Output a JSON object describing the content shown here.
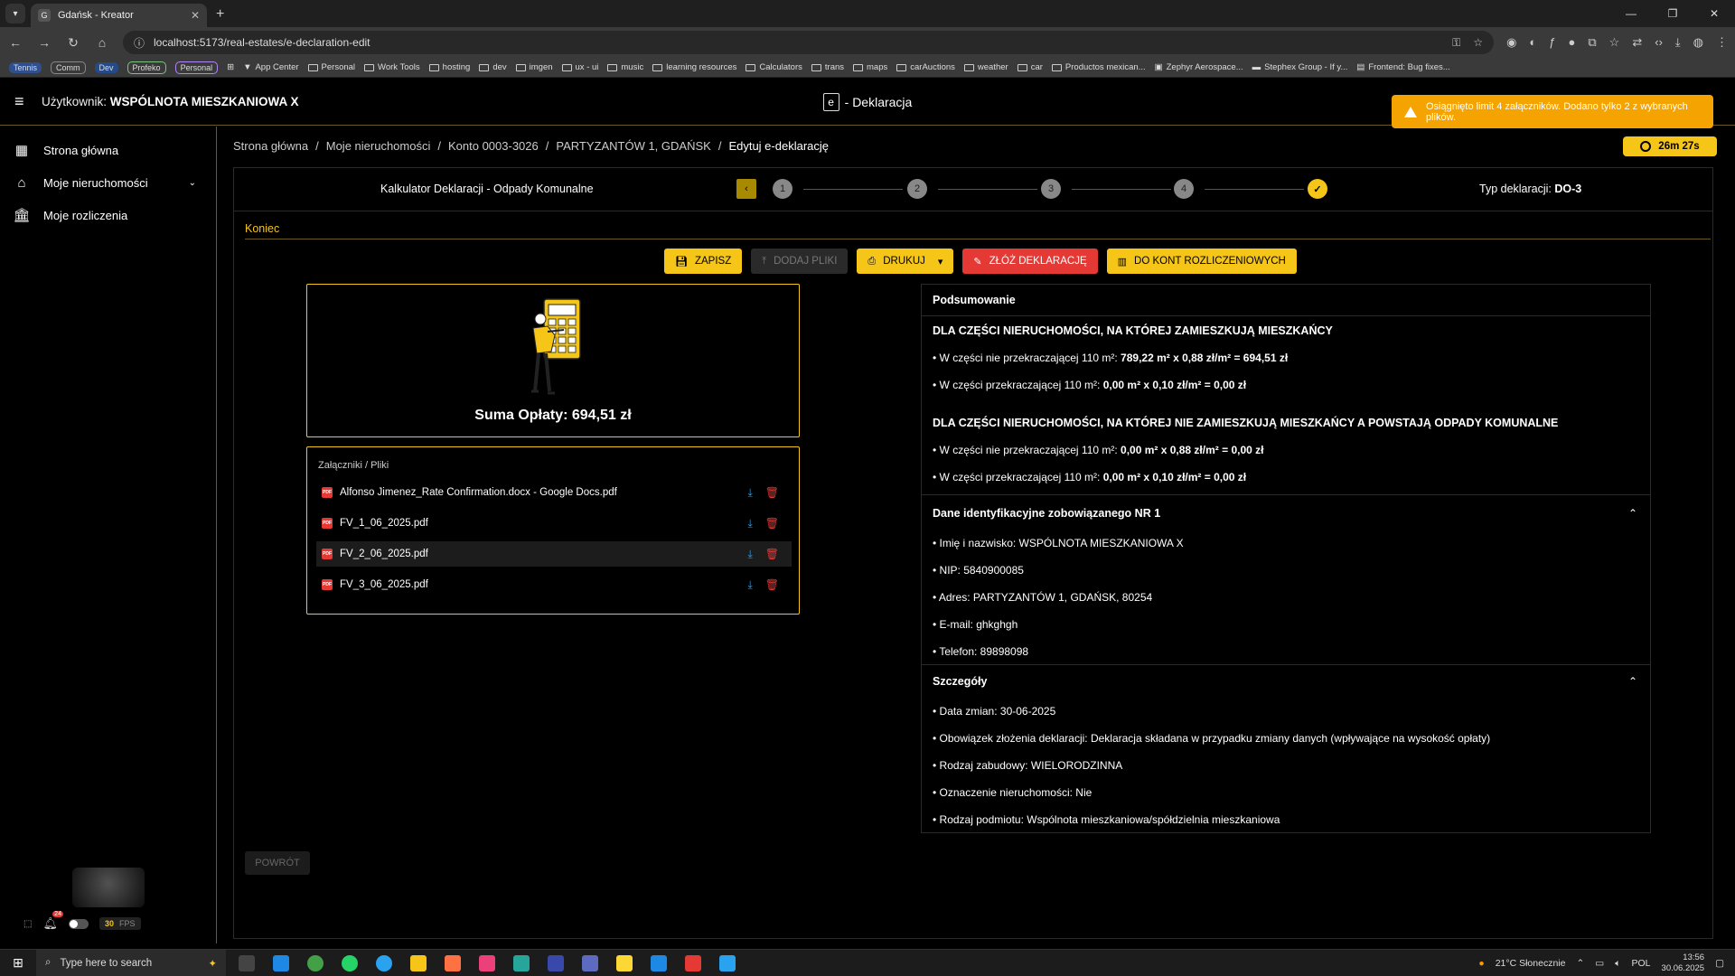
{
  "browser": {
    "tab_title": "Gdańsk - Kreator",
    "url": "localhost:5173/real-estates/e-declaration-edit",
    "bookmarks_pills": [
      "Tennis",
      "Comm",
      "Dev",
      "Profeko",
      "Personal"
    ],
    "bookmarks": [
      "App Center",
      "Personal",
      "Work Tools",
      "hosting",
      "dev",
      "imgen",
      "ux - ui",
      "music",
      "learning resources",
      "Calculators",
      "trans",
      "maps",
      "carAuctions",
      "weather",
      "car",
      "Productos mexican...",
      "Zephyr Aerospace...",
      "Stephex Group - If y...",
      "Frontend: Bug fixes..."
    ]
  },
  "header": {
    "user_prefix": "Użytkownik:",
    "user_name": "WSPÓLNOTA MIESZKANIOWA X",
    "e_letter": "e",
    "title": "- Deklaracja"
  },
  "toast": {
    "message": "Osiągnięto limit 4 załączników. Dodano tylko 2 z wybranych plików."
  },
  "sidebar": {
    "items": [
      {
        "label": "Strona główna"
      },
      {
        "label": "Moje nieruchomości"
      },
      {
        "label": "Moje rozliczenia"
      }
    ],
    "notifications_count": "24",
    "fps_value": "30",
    "fps_label": "FPS"
  },
  "breadcrumb": {
    "items": [
      "Strona główna",
      "Moje nieruchomości",
      "Konto 0003-3026",
      "PARTYZANTÓW 1, GDAŃSK"
    ],
    "current": "Edytuj e-deklarację",
    "separator": "/"
  },
  "timer": "26m 27s",
  "stepper": {
    "title": "Kalkulator Deklaracji - Odpady Komunalne",
    "steps": [
      "1",
      "2",
      "3",
      "4"
    ],
    "type_label": "Typ deklaracji:",
    "type_value": "DO-3"
  },
  "section_label": "Koniec",
  "actions": {
    "save": "ZAPISZ",
    "add_files": "DODAJ PLIKI",
    "print": "DRUKUJ",
    "submit": "ZŁÓŻ DEKLARACJĘ",
    "accounts": "DO KONT ROZLICZENIOWYCH"
  },
  "sum": {
    "label": "Suma Opłaty: 694,51 zł"
  },
  "attachments": {
    "title": "Załączniki / Pliki",
    "files": [
      "Alfonso Jimenez_Rate Confirmation.docx - Google Docs.pdf",
      "FV_1_06_2025.pdf",
      "FV_2_06_2025.pdf",
      "FV_3_06_2025.pdf"
    ]
  },
  "summary": {
    "title": "Podsumowanie",
    "section1": {
      "heading": "DLA CZĘŚCI NIERUCHOMOŚCI, NA KTÓREJ ZAMIESZKUJĄ MIESZKAŃCY",
      "line1_prefix": "• W części nie przekraczającej 110 m²: ",
      "line1_value": "789,22 m² x 0,88 zł/m² = 694,51 zł",
      "line2_prefix": "• W części przekraczającej 110 m²: ",
      "line2_value": "0,00 m² x 0,10 zł/m² = 0,00 zł"
    },
    "section2": {
      "heading": "DLA CZĘŚCI NIERUCHOMOŚCI, NA KTÓREJ NIE ZAMIESZKUJĄ MIESZKAŃCY A POWSTAJĄ ODPADY KOMUNALNE",
      "line1_prefix": "• W części nie przekraczającej 110 m²: ",
      "line1_value": "0,00 m² x 0,88 zł/m² = 0,00 zł",
      "line2_prefix": "• W części przekraczającej 110 m²: ",
      "line2_value": "0,00 m² x 0,10 zł/m² = 0,00 zł"
    },
    "ident": {
      "heading": "Dane identyfikacyjne zobowiązanego NR 1",
      "lines": [
        "• Imię i nazwisko: WSPÓLNOTA MIESZKANIOWA X",
        "• NIP: 5840900085",
        "• Adres: PARTYZANTÓW 1, GDAŃSK, 80254",
        "• E-mail: ghkghgh",
        "• Telefon: 89898098"
      ]
    },
    "details": {
      "heading": "Szczegóły",
      "lines": [
        "• Data zmian: 30-06-2025",
        "• Obowiązek złożenia deklaracji: Deklaracja składana w przypadku zmiany danych (wpływające na wysokość opłaty)",
        "• Rodzaj zabudowy: WIELORODZINNA",
        "• Oznaczenie nieruchomości: Nie",
        "• Rodzaj podmiotu: Wspólnota mieszkaniowa/spółdzielnia mieszkaniowa"
      ]
    }
  },
  "back_button": "POWRÓT",
  "taskbar": {
    "search_placeholder": "Type here to search",
    "weather": "21°C Słonecznie",
    "lang": "POL",
    "time": "13:56",
    "date": "30.06.2025"
  },
  "colors": {
    "accent": "#f5c518",
    "danger": "#e53935",
    "toast": "#f5a300",
    "download": "#29a3f0"
  }
}
